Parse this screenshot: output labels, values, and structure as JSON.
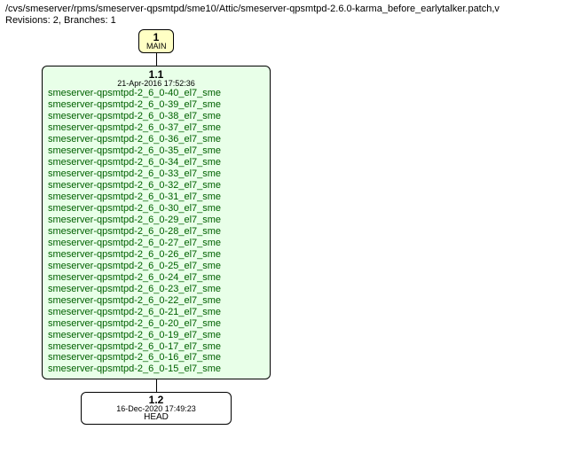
{
  "header": {
    "path": "/cvs/smeserver/rpms/smeserver-qpsmtpd/sme10/Attic/smeserver-qpsmtpd-2.6.0-karma_before_earlytalker.patch,v",
    "meta": "Revisions: 2, Branches: 1"
  },
  "nodes": {
    "main": {
      "version": "1",
      "label": "MAIN"
    },
    "tags": {
      "version": "1.1",
      "date": "21-Apr-2016 17:52:36",
      "items": [
        "smeserver-qpsmtpd-2_6_0-40_el7_sme",
        "smeserver-qpsmtpd-2_6_0-39_el7_sme",
        "smeserver-qpsmtpd-2_6_0-38_el7_sme",
        "smeserver-qpsmtpd-2_6_0-37_el7_sme",
        "smeserver-qpsmtpd-2_6_0-36_el7_sme",
        "smeserver-qpsmtpd-2_6_0-35_el7_sme",
        "smeserver-qpsmtpd-2_6_0-34_el7_sme",
        "smeserver-qpsmtpd-2_6_0-33_el7_sme",
        "smeserver-qpsmtpd-2_6_0-32_el7_sme",
        "smeserver-qpsmtpd-2_6_0-31_el7_sme",
        "smeserver-qpsmtpd-2_6_0-30_el7_sme",
        "smeserver-qpsmtpd-2_6_0-29_el7_sme",
        "smeserver-qpsmtpd-2_6_0-28_el7_sme",
        "smeserver-qpsmtpd-2_6_0-27_el7_sme",
        "smeserver-qpsmtpd-2_6_0-26_el7_sme",
        "smeserver-qpsmtpd-2_6_0-25_el7_sme",
        "smeserver-qpsmtpd-2_6_0-24_el7_sme",
        "smeserver-qpsmtpd-2_6_0-23_el7_sme",
        "smeserver-qpsmtpd-2_6_0-22_el7_sme",
        "smeserver-qpsmtpd-2_6_0-21_el7_sme",
        "smeserver-qpsmtpd-2_6_0-20_el7_sme",
        "smeserver-qpsmtpd-2_6_0-19_el7_sme",
        "smeserver-qpsmtpd-2_6_0-17_el7_sme",
        "smeserver-qpsmtpd-2_6_0-16_el7_sme",
        "smeserver-qpsmtpd-2_6_0-15_el7_sme"
      ]
    },
    "head": {
      "version": "1.2",
      "date": "16-Dec-2020 17:49:23",
      "label": "HEAD"
    }
  }
}
